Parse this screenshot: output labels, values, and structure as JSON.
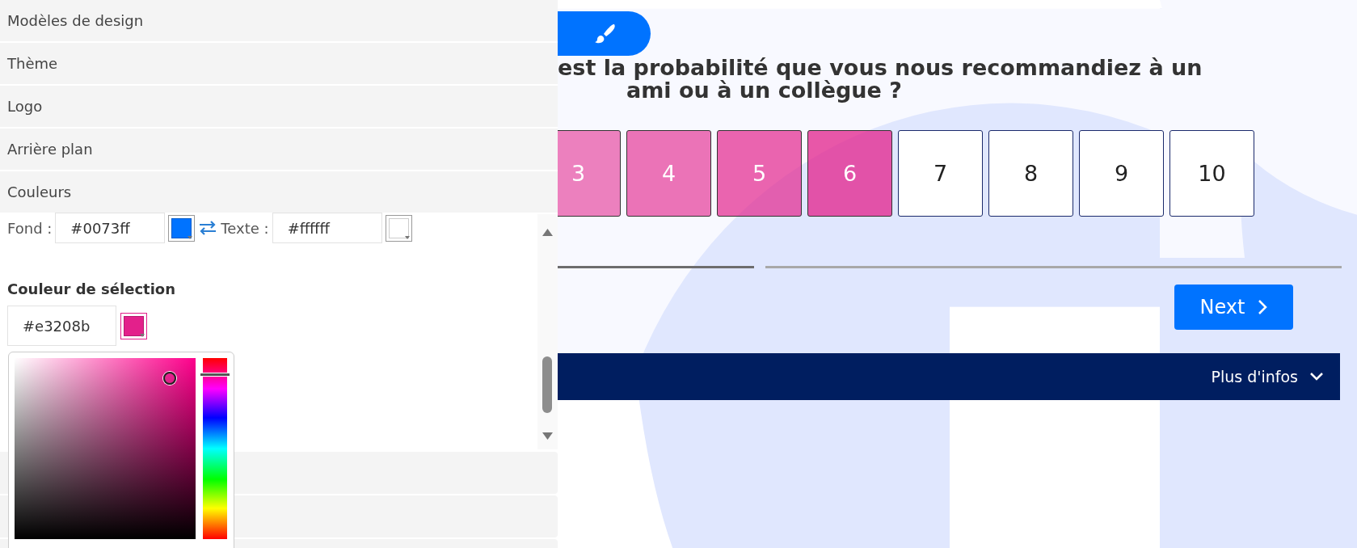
{
  "design_panel": {
    "sections": [
      {
        "title": "Modèles de design"
      },
      {
        "title": "Thème"
      },
      {
        "title": "Logo"
      },
      {
        "title": "Arrière plan"
      },
      {
        "title": "Couleurs"
      }
    ],
    "button_colors": {
      "background_label": "Fond :",
      "background_value": "#0073ff",
      "text_label": "Texte :",
      "text_value": "#ffffff"
    },
    "selection_color": {
      "title": "Couleur de sélection",
      "value": "#e3208b",
      "picker_open": true
    }
  },
  "survey": {
    "question_line_1": "est la probabilité que vous nous recommandiez à un",
    "question_line_2": "ami ou à un collègue ?",
    "scale": [
      {
        "label": "3",
        "selected": true
      },
      {
        "label": "4",
        "selected": true
      },
      {
        "label": "5",
        "selected": true
      },
      {
        "label": "6",
        "selected": true
      },
      {
        "label": "7",
        "selected": false
      },
      {
        "label": "8",
        "selected": false
      },
      {
        "label": "9",
        "selected": false
      },
      {
        "label": "10",
        "selected": false
      }
    ],
    "progress": {
      "level": 0.25
    },
    "next_button": "Next",
    "footer": {
      "label": "Plus d'infos"
    }
  }
}
